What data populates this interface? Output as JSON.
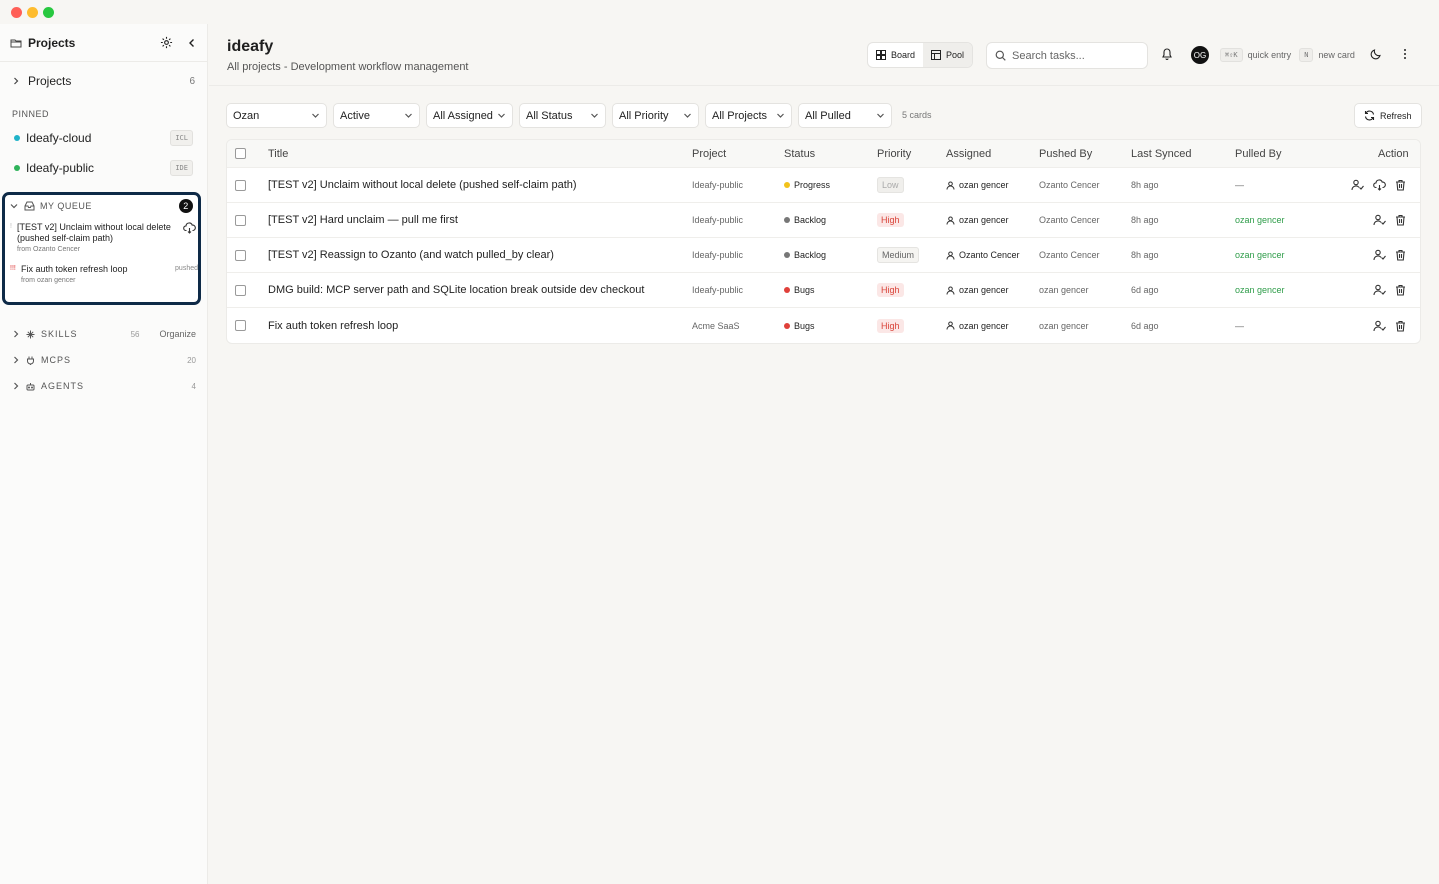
{
  "colors": {
    "accent_dark": "#0e2a47",
    "pin_cloud": "#1fb3c9",
    "pin_public": "#2fb35a",
    "status_progress": "#f2c21b",
    "status_backlog": "#777777",
    "status_bugs": "#e0403a",
    "pulled_green": "#2f9d4a"
  },
  "sidebar": {
    "title": "Projects",
    "projects_label": "Projects",
    "projects_count": "6",
    "pinned_heading": "PINNED",
    "pinned": [
      {
        "label": "Ideafy-cloud",
        "code": "ICL",
        "color": "#1fb3c9"
      },
      {
        "label": "Ideafy-public",
        "code": "IDE",
        "color": "#2fb35a"
      }
    ],
    "queue": {
      "label": "MY QUEUE",
      "count": "2",
      "items": [
        {
          "title": "[TEST v2] Unclaim without local delete (pushed self-claim path)",
          "from": "from Ozanto Cencer",
          "icon": "cloud-download-icon"
        },
        {
          "title": "Fix auth token refresh loop",
          "from": "from ozan gencer",
          "mark": "!!!",
          "tag": "pushed"
        }
      ]
    },
    "sections": [
      {
        "label": "SKILLS",
        "count": "56",
        "extra": "Organize",
        "icon": "sparkle-icon"
      },
      {
        "label": "MCPS",
        "count": "20",
        "icon": "plug-icon"
      },
      {
        "label": "AGENTS",
        "count": "4",
        "icon": "robot-icon"
      }
    ]
  },
  "header": {
    "title": "ideafy",
    "subtitle": "All projects - Development workflow management",
    "board_label": "Board",
    "pool_label": "Pool",
    "search_placeholder": "Search tasks...",
    "avatar": "OG",
    "shortcut_key1": "⌘⇧K",
    "shortcut_label1": "quick entry",
    "shortcut_key2": "N",
    "shortcut_label2": "new card"
  },
  "filters": {
    "user": "Ozan",
    "state": "Active",
    "assigned": "All Assigned",
    "status": "All Status",
    "priority": "All Priority",
    "projects": "All Projects",
    "pulled": "All Pulled",
    "count": "5 cards",
    "refresh": "Refresh"
  },
  "table": {
    "columns": {
      "title": "Title",
      "project": "Project",
      "status": "Status",
      "priority": "Priority",
      "assigned": "Assigned",
      "pushed_by": "Pushed By",
      "last_synced": "Last Synced",
      "pulled_by": "Pulled By",
      "action": "Action"
    },
    "rows": [
      {
        "title": "[TEST v2] Unclaim without local delete (pushed self-claim path)",
        "project": "Ideafy-public",
        "status": "Progress",
        "status_color": "#f2c21b",
        "priority": "Low",
        "priority_class": "low",
        "assigned": "ozan gencer",
        "pushed_by": "Ozanto Cencer",
        "last_synced": "8h ago",
        "pulled_by": "—",
        "pulled_green": false,
        "has_cloud": true
      },
      {
        "title": "[TEST v2] Hard unclaim — pull me first",
        "project": "Ideafy-public",
        "status": "Backlog",
        "status_color": "#777777",
        "priority": "High",
        "priority_class": "high",
        "assigned": "ozan gencer",
        "pushed_by": "Ozanto Cencer",
        "last_synced": "8h ago",
        "pulled_by": "ozan gencer",
        "pulled_green": true,
        "has_cloud": false
      },
      {
        "title": "[TEST v2] Reassign to Ozanto (and watch pulled_by clear)",
        "project": "Ideafy-public",
        "status": "Backlog",
        "status_color": "#777777",
        "priority": "Medium",
        "priority_class": "medium",
        "assigned": "Ozanto Cencer",
        "pushed_by": "Ozanto Cencer",
        "last_synced": "8h ago",
        "pulled_by": "ozan gencer",
        "pulled_green": true,
        "has_cloud": false
      },
      {
        "title": "DMG build: MCP server path and SQLite location break outside dev checkout",
        "project": "Ideafy-public",
        "status": "Bugs",
        "status_color": "#e0403a",
        "priority": "High",
        "priority_class": "high",
        "assigned": "ozan gencer",
        "pushed_by": "ozan gencer",
        "last_synced": "6d ago",
        "pulled_by": "ozan gencer",
        "pulled_green": true,
        "has_cloud": false
      },
      {
        "title": "Fix auth token refresh loop",
        "project": "Acme SaaS",
        "status": "Bugs",
        "status_color": "#e0403a",
        "priority": "High",
        "priority_class": "high",
        "assigned": "ozan gencer",
        "pushed_by": "ozan gencer",
        "last_synced": "6d ago",
        "pulled_by": "—",
        "pulled_green": false,
        "has_cloud": false
      }
    ]
  }
}
